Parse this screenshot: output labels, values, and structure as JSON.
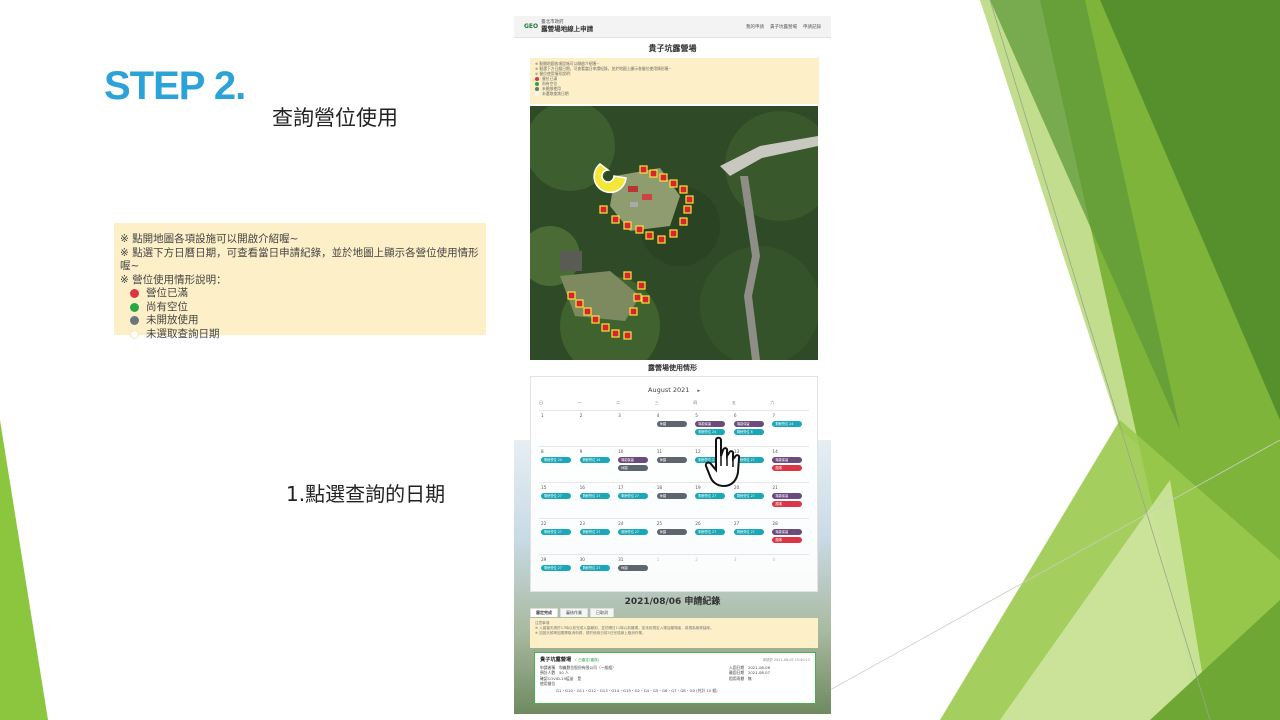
{
  "slide": {
    "step_title": "STEP 2.",
    "subtitle": "查詢營位使用",
    "instruction": "1.點選查詢的日期"
  },
  "callout": {
    "lines": [
      "※ 點開地圖各項設施可以開啟介紹喔~",
      "※ 點選下方日曆日期，可查看當日申請紀錄，並於地圖上顯示各營位使用情形喔~",
      "※ 營位使用情形說明："
    ],
    "legend": [
      {
        "label": "營位已滿",
        "color": "#dc3545"
      },
      {
        "label": "尚有空位",
        "color": "#28a745"
      },
      {
        "label": "未開放使用",
        "color": "#6c757d"
      },
      {
        "label": "未選取查詢日期",
        "color": "#ffffff"
      }
    ]
  },
  "app": {
    "brand_logo": "GEO",
    "brand_line1": "臺北市政府",
    "brand_line2": "露營場地線上申請",
    "nav": [
      "我的申請",
      "貴子坑露營場",
      "申請記錄"
    ],
    "page_title": "貴子坑露營場",
    "info_lines": [
      "※ 點開地圖各項設施可以開啟介紹喔~",
      "※ 點選下方日曆日期，可查看當日申請紀錄，並於地圖上顯示各營位使用情形喔~",
      "※ 營位使用情形說明："
    ],
    "info_legend": [
      {
        "label": "營位已滿",
        "color": "#dc3545"
      },
      {
        "label": "尚有空位",
        "color": "#28a745"
      },
      {
        "label": "未開放使用",
        "color": "#6c757d"
      },
      {
        "label": "未選取查詢日期",
        "color": "#f5f5f5"
      }
    ]
  },
  "calendar": {
    "title": "露營場使用情形",
    "month": "August 2021",
    "next": "▸",
    "weekdays": [
      "日",
      "一",
      "二",
      "三",
      "四",
      "五",
      "六"
    ],
    "weeks": [
      [
        {
          "d": "1",
          "p": []
        },
        {
          "d": "2",
          "p": []
        },
        {
          "d": "3",
          "p": []
        },
        {
          "d": "4",
          "p": [
            {
              "t": "休園",
              "s": "closed"
            }
          ]
        },
        {
          "d": "5",
          "p": [
            {
              "t": "場勘保留",
              "s": "used"
            },
            {
              "t": "剩餘營位 24",
              "s": "avail"
            }
          ]
        },
        {
          "d": "6",
          "p": [
            {
              "t": "場勘保留",
              "s": "used"
            },
            {
              "t": "剩餘營位 8",
              "s": "avail"
            }
          ]
        },
        {
          "d": "7",
          "p": [
            {
              "t": "剩餘營位 24",
              "s": "avail"
            }
          ]
        }
      ],
      [
        {
          "d": "8",
          "p": [
            {
              "t": "剩餘營位 24",
              "s": "avail"
            }
          ]
        },
        {
          "d": "9",
          "p": [
            {
              "t": "剩餘營位 24",
              "s": "avail"
            }
          ]
        },
        {
          "d": "10",
          "p": [
            {
              "t": "場勘保留",
              "s": "used"
            },
            {
              "t": "休園",
              "s": "closed"
            }
          ]
        },
        {
          "d": "11",
          "p": [
            {
              "t": "休園",
              "s": "closed"
            }
          ]
        },
        {
          "d": "12",
          "p": [
            {
              "t": "剩餘營位 27",
              "s": "avail"
            }
          ]
        },
        {
          "d": "13",
          "p": [
            {
              "t": "剩餘營位 27",
              "s": "avail"
            }
          ]
        },
        {
          "d": "14",
          "p": [
            {
              "t": "場勘保留",
              "s": "used"
            },
            {
              "t": "額滿",
              "s": "full"
            }
          ]
        }
      ],
      [
        {
          "d": "15",
          "p": [
            {
              "t": "剩餘營位 27",
              "s": "avail"
            }
          ]
        },
        {
          "d": "16",
          "p": [
            {
              "t": "剩餘營位 27",
              "s": "avail"
            }
          ]
        },
        {
          "d": "17",
          "p": [
            {
              "t": "剩餘營位 27",
              "s": "avail"
            }
          ]
        },
        {
          "d": "18",
          "p": [
            {
              "t": "休園",
              "s": "closed"
            }
          ]
        },
        {
          "d": "19",
          "p": [
            {
              "t": "剩餘營位 27",
              "s": "avail"
            }
          ]
        },
        {
          "d": "20",
          "p": [
            {
              "t": "剩餘營位 27",
              "s": "avail"
            }
          ]
        },
        {
          "d": "21",
          "p": [
            {
              "t": "場勘保留",
              "s": "used"
            },
            {
              "t": "額滿",
              "s": "full"
            }
          ]
        }
      ],
      [
        {
          "d": "22",
          "p": [
            {
              "t": "剩餘營位 27",
              "s": "avail"
            }
          ]
        },
        {
          "d": "23",
          "p": [
            {
              "t": "剩餘營位 27",
              "s": "avail"
            }
          ]
        },
        {
          "d": "24",
          "p": [
            {
              "t": "剩餘營位 27",
              "s": "avail"
            }
          ]
        },
        {
          "d": "25",
          "p": [
            {
              "t": "休園",
              "s": "closed"
            }
          ]
        },
        {
          "d": "26",
          "p": [
            {
              "t": "剩餘營位 27",
              "s": "avail"
            }
          ]
        },
        {
          "d": "27",
          "p": [
            {
              "t": "剩餘營位 27",
              "s": "avail"
            }
          ]
        },
        {
          "d": "28",
          "p": [
            {
              "t": "場勘保留",
              "s": "used"
            },
            {
              "t": "額滿",
              "s": "full"
            }
          ]
        }
      ],
      [
        {
          "d": "29",
          "p": [
            {
              "t": "剩餘營位 27",
              "s": "avail"
            }
          ]
        },
        {
          "d": "30",
          "p": [
            {
              "t": "剩餘營位 27",
              "s": "avail"
            }
          ]
        },
        {
          "d": "31",
          "p": [
            {
              "t": "休園",
              "s": "closed"
            }
          ]
        },
        {
          "d": "1",
          "p": [],
          "muted": true
        },
        {
          "d": "2",
          "p": [],
          "muted": true
        },
        {
          "d": "3",
          "p": [],
          "muted": true
        },
        {
          "d": "4",
          "p": [],
          "muted": true
        }
      ]
    ]
  },
  "record": {
    "title": "2021/08/06 申請紀錄",
    "tabs": [
      "審定完成",
      "審核作業",
      "已取消"
    ],
    "notice_title": "注意事項",
    "notice_lines": [
      "※ 入園當天請於17時以前完成入園報到，並於隔日11時以前離場，如未依規定入場及離場者，將視為無故缺席。",
      "※ 如因天候等因素需取消申請，請於使用日前3日完成線上取消作業。"
    ],
    "site_name": "貴子坑露營場",
    "status": "✓ 已審定(審核)",
    "applied_at": "申請於 2021-08-02 15:40:12",
    "left_labels": [
      "申請者稱",
      "預計人數",
      "確認COVID-19疫苗",
      "使用營位"
    ],
    "left_values": [
      "和義數位股份有限公司（一般組）",
      "50 人",
      "是",
      ""
    ],
    "right_labels": [
      "入園日期",
      "離園日期",
      "租用雨棚"
    ],
    "right_values": [
      "2021-08-06",
      "2021-08-07",
      "無"
    ],
    "sites": "G1・G10・G11・G12・G13・G14・G15・G2・G4・G5・G6・G7・G8・G9 (共計 15 組)"
  }
}
